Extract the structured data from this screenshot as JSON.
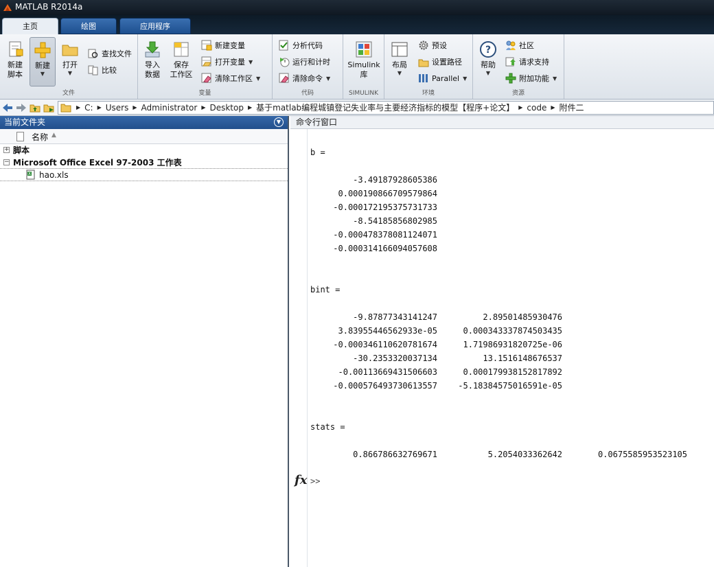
{
  "window": {
    "title": "MATLAB R2014a"
  },
  "tabs": [
    {
      "label": "主页",
      "active": true
    },
    {
      "label": "绘图",
      "active": false
    },
    {
      "label": "应用程序",
      "active": false
    }
  ],
  "ribbon": {
    "file": {
      "group_label": "文件",
      "new_script": "新建\n脚本",
      "new": "新建",
      "open": "打开",
      "find_files": "查找文件",
      "compare": "比较"
    },
    "variable": {
      "group_label": "变量",
      "import_data": "导入\n数据",
      "save_workspace": "保存\n工作区",
      "new_variable": "新建变量",
      "open_variable": "打开变量",
      "clear_workspace": "清除工作区"
    },
    "code": {
      "group_label": "代码",
      "analyze_code": "分析代码",
      "run_and_time": "运行和计时",
      "clear_commands": "清除命令"
    },
    "simulink": {
      "group_label": "SIMULINK",
      "simulink_library": "Simulink\n库"
    },
    "environment": {
      "group_label": "环境",
      "layout": "布局",
      "preferences": "预设",
      "set_path": "设置路径",
      "parallel": "Parallel"
    },
    "resources": {
      "group_label": "资源",
      "help": "帮助",
      "community": "社区",
      "request_support": "请求支持",
      "add_ons": "附加功能"
    }
  },
  "address": {
    "crumbs": [
      "C:",
      "Users",
      "Administrator",
      "Desktop",
      "基于matlab编程城镇登记失业率与主要经济指标的模型【程序+论文】",
      "code",
      "附件二"
    ]
  },
  "current_folder": {
    "title": "当前文件夹",
    "column_name": "名称",
    "groups": [
      {
        "label": "脚本",
        "expanded": false
      },
      {
        "label": "Microsoft Office Excel 97-2003 工作表",
        "expanded": true
      }
    ],
    "files": [
      "hao.xls"
    ]
  },
  "command_window": {
    "title": "命令行窗口",
    "b_label": "b =",
    "b": [
      "-3.49187928605386",
      "0.000190866709579864",
      "-0.000172195375731733",
      "-8.54185856802985",
      "-0.000478378081124071",
      "-0.000314166094057608"
    ],
    "bint_label": "bint =",
    "bint": [
      [
        "-9.87877343141247",
        "2.89501485930476"
      ],
      [
        "3.83955446562933e-05",
        "0.000343337874503435"
      ],
      [
        "-0.000346110620781674",
        "1.71986931820725e-06"
      ],
      [
        "-30.2353320037134",
        "13.1516148676537"
      ],
      [
        "-0.00113669431506603",
        "0.000179938152817892"
      ],
      [
        "-0.000576493730613557",
        "-5.18384575016591e-05"
      ]
    ],
    "stats_label": "stats =",
    "stats": [
      "0.866786632769671",
      "5.2054033362642",
      "0.0675585953523105"
    ],
    "fx": "fx",
    "prompt": ">>"
  }
}
